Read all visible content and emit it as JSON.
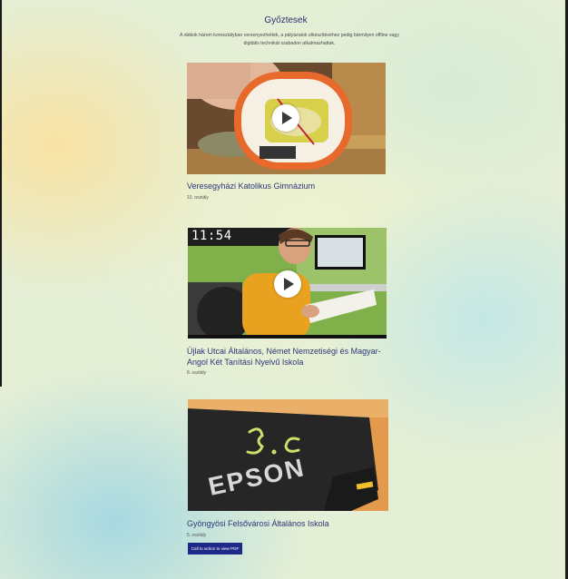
{
  "page": {
    "title": "Győztesek",
    "intro": "A diákok három korosztályban versenyezhettek, a pályázatok elkészítéséhez pedig bármilyen offline vagy digitális technikát szabadon alkalmazhattak."
  },
  "cards": [
    {
      "title": "Veresegyházi Katolikus Gimnázium",
      "grade": "10. osztály",
      "media": "video",
      "play_icon": "play-icon"
    },
    {
      "title": "Újlak Utcai Általános, Német Nemzetiségi és Magyar-Angol Két Tanítási Nyelvű Iskola",
      "grade": "8. osztály",
      "media": "video",
      "play_icon": "play-icon",
      "timestamp": "11:54"
    },
    {
      "title": "Gyöngyösi Felsővárosi Általános Iskola",
      "grade": "5. osztály",
      "media": "image",
      "image_text": {
        "chalk": "3.c",
        "brand": "EPSON"
      },
      "button_label": "Call to action to view PDF"
    }
  ],
  "colors": {
    "title": "#2a2f6b",
    "card_title": "#2e3478",
    "button_bg": "#1e2a8a"
  }
}
